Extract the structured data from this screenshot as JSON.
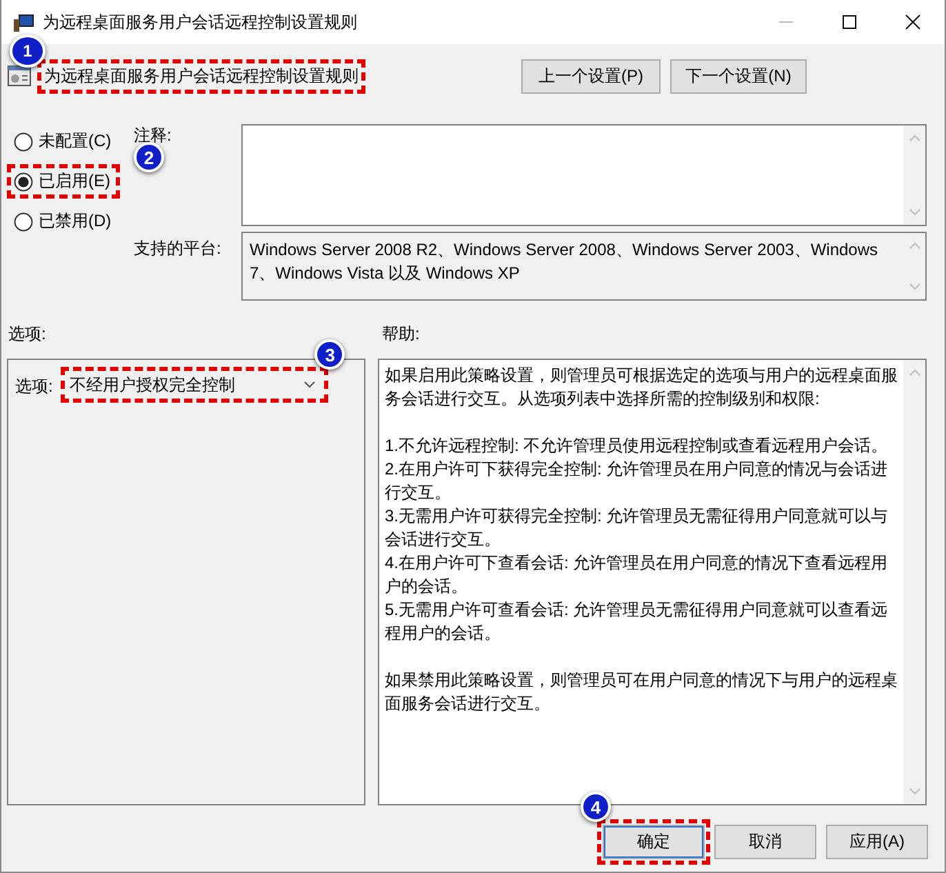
{
  "window": {
    "title": "为远程桌面服务用户会话远程控制设置规则"
  },
  "header": {
    "title": "为远程桌面服务用户会话远程控制设置规则",
    "highlighted": true,
    "callout": "1"
  },
  "nav_buttons": [
    {
      "label": "上一个设置(P)"
    },
    {
      "label": "下一个设置(N)"
    }
  ],
  "state_options": [
    {
      "label": "未配置(C)",
      "selected": false,
      "highlighted": false
    },
    {
      "label": "已启用(E)",
      "selected": true,
      "highlighted": true,
      "callout": "2"
    },
    {
      "label": "已禁用(D)",
      "selected": false,
      "highlighted": false
    }
  ],
  "comment": {
    "label": "注释:"
  },
  "platform": {
    "label": "支持的平台:",
    "value": "Windows Server 2008 R2、Windows Server 2008、Windows Server 2003、Windows 7、Windows Vista 以及 Windows XP"
  },
  "options": {
    "heading": "选项:",
    "field_label": "选项:",
    "dropdown": {
      "value": "不经用户授权完全控制",
      "highlighted": true,
      "callout": "3"
    }
  },
  "help": {
    "heading": "帮助:",
    "sections": [
      [
        "如果启用此策略设置，则管理员可根据选定的选项与用户的远程桌面服务会话进行交互。从选项列表中选择所需的控制级别和权限:"
      ],
      [
        "1.不允许远程控制: 不允许管理员使用远程控制或查看远程用户会话。",
        "2.在用户许可下获得完全控制: 允许管理员在用户同意的情况与会话进行交互。",
        "3.无需用户许可获得完全控制: 允许管理员无需征得用户同意就可以与会话进行交互。",
        "4.在用户许可下查看会话: 允许管理员在用户同意的情况下查看远程用户的会话。",
        "5.无需用户许可查看会话: 允许管理员无需征得用户同意就可以查看远程用户的会话。"
      ],
      [
        "如果禁用此策略设置，则管理员可在用户同意的情况下与用户的远程桌面服务会话进行交互。"
      ]
    ]
  },
  "footer_buttons": [
    {
      "label": "确定",
      "highlighted": true,
      "callout": "4"
    },
    {
      "label": "取消",
      "highlighted": false
    },
    {
      "label": "应用(A)",
      "highlighted": false
    }
  ]
}
